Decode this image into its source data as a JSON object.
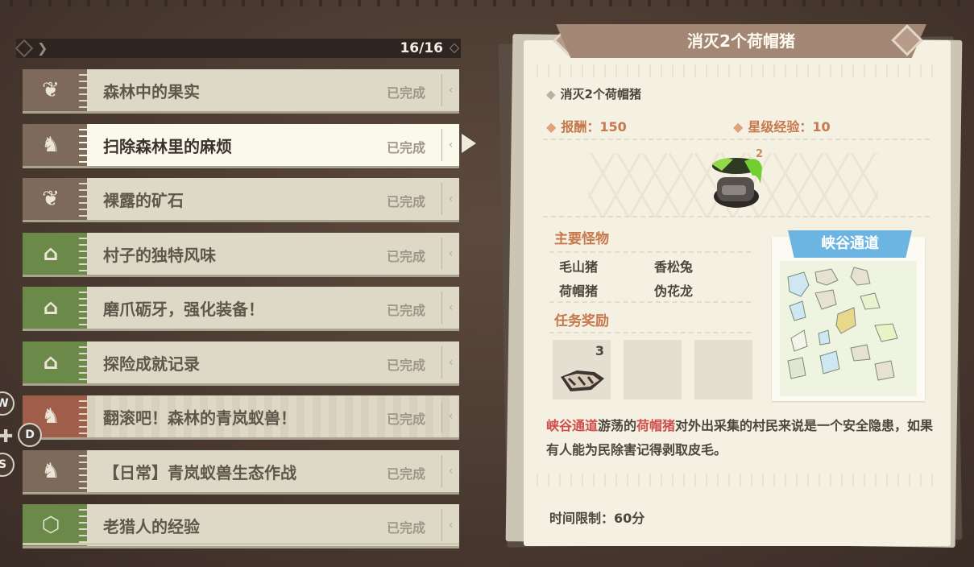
{
  "quest_list": {
    "count": "16/16",
    "items": [
      {
        "title": "森林中的果实",
        "status": "已完成",
        "icon": "leaf-icon",
        "icon_glyph": "❦",
        "color": "brown",
        "selected": false,
        "highlight": false
      },
      {
        "title": "扫除森林里的麻烦",
        "status": "已完成",
        "icon": "beast-head-icon",
        "icon_glyph": "♞",
        "color": "brown",
        "selected": true,
        "highlight": false
      },
      {
        "title": "裸露的矿石",
        "status": "已完成",
        "icon": "leaf-icon",
        "icon_glyph": "❦",
        "color": "brown",
        "selected": false,
        "highlight": false
      },
      {
        "title": "村子的独特风味",
        "status": "已完成",
        "icon": "house-icon",
        "icon_glyph": "⌂",
        "color": "green",
        "selected": false,
        "highlight": false
      },
      {
        "title": "磨爪砺牙，强化装备！",
        "status": "已完成",
        "icon": "house-icon",
        "icon_glyph": "⌂",
        "color": "green",
        "selected": false,
        "highlight": false
      },
      {
        "title": "探险成就记录",
        "status": "已完成",
        "icon": "house-icon",
        "icon_glyph": "⌂",
        "color": "green",
        "selected": false,
        "highlight": false
      },
      {
        "title": "翻滚吧！森林的青岚蚁兽！",
        "status": "已完成",
        "icon": "beast-head-icon",
        "icon_glyph": "♞",
        "color": "red",
        "selected": false,
        "highlight": true
      },
      {
        "title": "【日常】青岚蚁兽生态作战",
        "status": "已完成",
        "icon": "beast-head-icon",
        "icon_glyph": "♞",
        "color": "brown",
        "selected": false,
        "highlight": false
      },
      {
        "title": "老猎人的经验",
        "status": "已完成",
        "icon": "hex-badge-icon",
        "icon_glyph": "⬡",
        "color": "green",
        "selected": false,
        "highlight": false
      }
    ]
  },
  "controls": {
    "w": "W",
    "d": "D",
    "s": "S"
  },
  "detail": {
    "title": "消灭2个荷帽猪",
    "objective": "消灭2个荷帽猪",
    "reward_label": "报酬：150",
    "exp_label": "星级经验：10",
    "target_count": "2",
    "main_monsters_heading": "主要怪物",
    "monsters": [
      "毛山猪",
      "香松兔",
      "荷帽猪",
      "伪花龙"
    ],
    "rewards_heading": "任务奖励",
    "reward_slots": [
      {
        "count": "3",
        "item": "hide-material-icon"
      },
      {
        "count": ""
      },
      {
        "count": ""
      }
    ],
    "map_label": "峡谷通道",
    "description": {
      "hl1": "峡谷通道",
      "t1": "游荡的",
      "hl2": "荷帽猪",
      "t2": "对外出采集的村民来说是一个安全隐患，如果有人能为民除害记得剥取皮毛。"
    },
    "time_limit": "时间限制：60分"
  },
  "colors": {
    "icon_brown": "#7d6a5b",
    "icon_green": "#6b8a4a",
    "icon_red": "#a05e4a",
    "accent_orange": "#c7784c",
    "highlight_red": "#d04f4a",
    "map_blue": "#6cb4e2"
  }
}
